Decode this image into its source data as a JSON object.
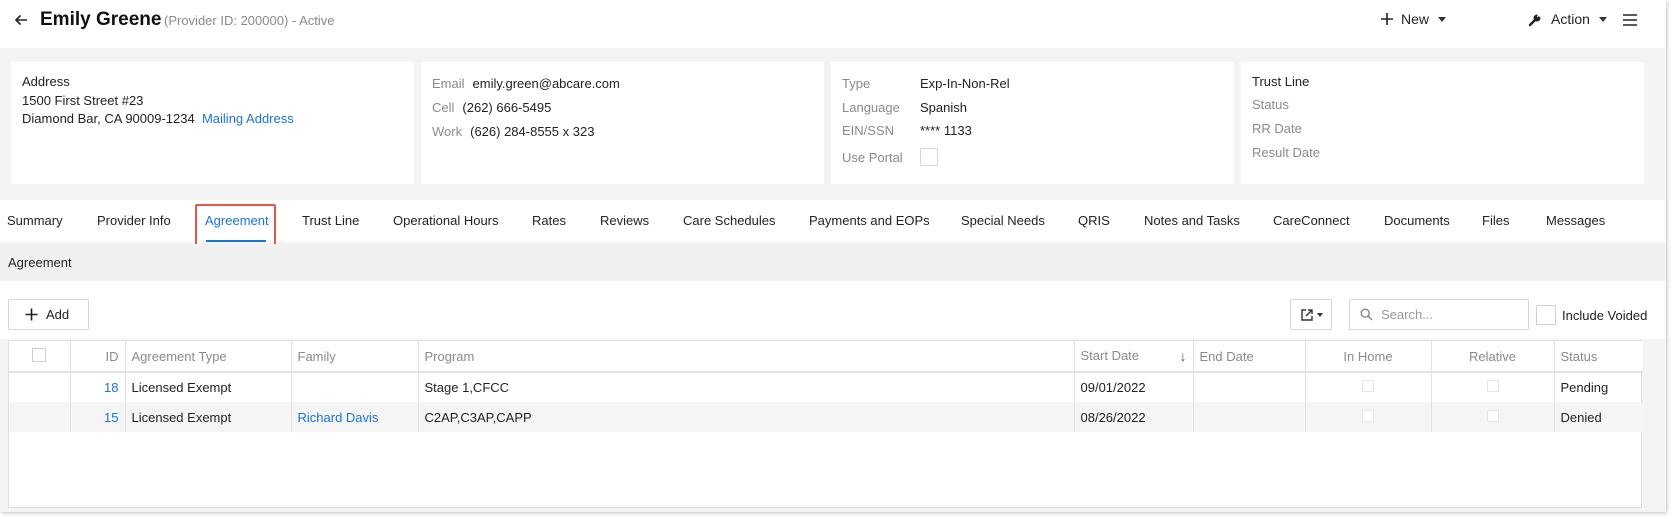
{
  "header": {
    "provider_name": "Emily Greene",
    "provider_meta": "(Provider ID: 200000) - Active",
    "new_label": "New",
    "action_label": "Action"
  },
  "address_card": {
    "label": "Address",
    "line1": "1500 First Street #23",
    "line2": "Diamond Bar, CA 90009-1234",
    "mailing_link": "Mailing Address"
  },
  "contact_card": {
    "email_label": "Email",
    "email": "emily.green@abcare.com",
    "cell_label": "Cell",
    "cell": "(262) 666-5495",
    "work_label": "Work",
    "work": "(626) 284-8555 x 323"
  },
  "type_card": {
    "type_label": "Type",
    "type": "Exp-In-Non-Rel",
    "language_label": "Language",
    "language": "Spanish",
    "ein_label": "EIN/SSN",
    "ein": "**** 1133",
    "portal_label": "Use Portal"
  },
  "trust_card": {
    "title": "Trust Line",
    "status_label": "Status",
    "rr_label": "RR Date",
    "result_label": "Result Date"
  },
  "tabs": [
    {
      "label": "Summary"
    },
    {
      "label": "Provider Info"
    },
    {
      "label": "Agreement"
    },
    {
      "label": "Trust Line"
    },
    {
      "label": "Operational Hours"
    },
    {
      "label": "Rates"
    },
    {
      "label": "Reviews"
    },
    {
      "label": "Care Schedules"
    },
    {
      "label": "Payments and EOPs"
    },
    {
      "label": "Special Needs"
    },
    {
      "label": "QRIS"
    },
    {
      "label": "Notes and Tasks"
    },
    {
      "label": "CareConnect"
    },
    {
      "label": "Documents"
    },
    {
      "label": "Files"
    },
    {
      "label": "Messages"
    }
  ],
  "active_tab": "Agreement",
  "section": {
    "title": "Agreement"
  },
  "toolbar": {
    "add_label": "Add",
    "search_placeholder": "Search...",
    "include_voided_label": "Include Voided"
  },
  "table": {
    "columns": [
      "ID",
      "Agreement Type",
      "Family",
      "Program",
      "Start Date",
      "End Date",
      "In Home",
      "Relative",
      "Status"
    ],
    "rows": [
      {
        "id": "18",
        "agreement_type": "Licensed Exempt",
        "family": "",
        "program": "Stage 1,CFCC",
        "start_date": "09/01/2022",
        "end_date": "",
        "status": "Pending"
      },
      {
        "id": "15",
        "agreement_type": "Licensed Exempt",
        "family": "Richard Davis",
        "program": "C2AP,C3AP,CAPP",
        "start_date": "08/26/2022",
        "end_date": "",
        "status": "Denied"
      }
    ]
  },
  "colors": {
    "accent": "#1a73d9",
    "highlight": "#e8554e"
  }
}
